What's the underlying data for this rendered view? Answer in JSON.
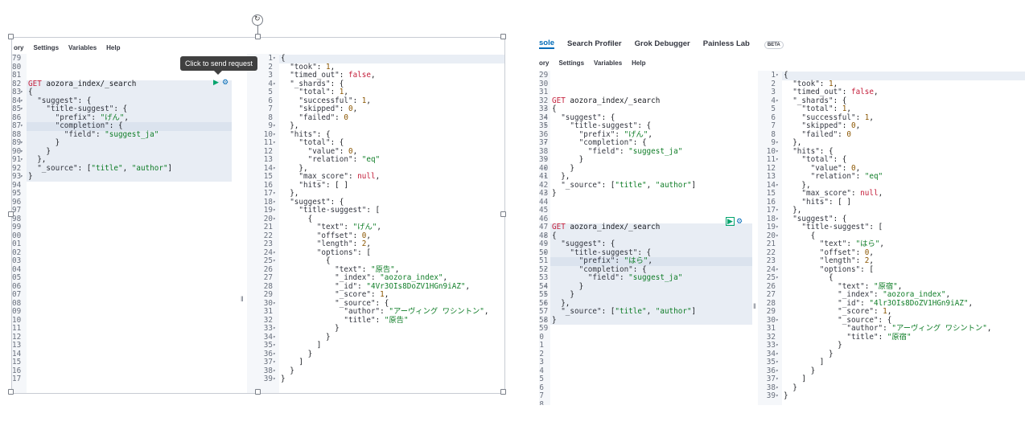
{
  "tooltip": "Click to send request",
  "menu": [
    "ory",
    "Settings",
    "Variables",
    "Help"
  ],
  "top_tabs": [
    "sole",
    "Search Profiler",
    "Grok Debugger",
    "Painless Lab",
    "BETA"
  ],
  "left_request": {
    "start_num": 79,
    "lines": [
      {
        "n": "79",
        "t": ""
      },
      {
        "n": "80",
        "t": ""
      },
      {
        "n": "81",
        "t": ""
      },
      {
        "n": "82",
        "t": "GET aozora_index/_search",
        "req": true
      },
      {
        "n": "83",
        "t": "{",
        "req": true,
        "fold": true
      },
      {
        "n": "84",
        "t": "  \"suggest\": {",
        "req": true,
        "fold": true
      },
      {
        "n": "85",
        "t": "    \"title-suggest\": {",
        "req": true,
        "fold": true
      },
      {
        "n": "86",
        "t": "      \"prefix\": \"げん\",",
        "req": true
      },
      {
        "n": "87",
        "t": "      \"completion\": {",
        "req": true,
        "fold": true,
        "active": true
      },
      {
        "n": "88",
        "t": "        \"field\": \"suggest_ja\"",
        "req": true
      },
      {
        "n": "89",
        "t": "      }",
        "req": true,
        "fold": true
      },
      {
        "n": "90",
        "t": "    }",
        "req": true,
        "fold": true
      },
      {
        "n": "91",
        "t": "  },",
        "req": true,
        "fold": true
      },
      {
        "n": "92",
        "t": "  \"_source\": [\"title\", \"author\"]",
        "req": true
      },
      {
        "n": "93",
        "t": "}",
        "req": true,
        "fold": true
      },
      {
        "n": "94",
        "t": ""
      },
      {
        "n": "95",
        "t": ""
      },
      {
        "n": "96",
        "t": ""
      },
      {
        "n": "97",
        "t": ""
      },
      {
        "n": "98",
        "t": ""
      },
      {
        "n": "99",
        "t": ""
      },
      {
        "n": "00",
        "t": ""
      },
      {
        "n": "01",
        "t": ""
      },
      {
        "n": "02",
        "t": ""
      },
      {
        "n": "03",
        "t": ""
      },
      {
        "n": "04",
        "t": ""
      },
      {
        "n": "05",
        "t": ""
      },
      {
        "n": "06",
        "t": ""
      },
      {
        "n": "07",
        "t": ""
      },
      {
        "n": "08",
        "t": ""
      },
      {
        "n": "09",
        "t": ""
      },
      {
        "n": "10",
        "t": ""
      },
      {
        "n": "11",
        "t": ""
      },
      {
        "n": "12",
        "t": ""
      },
      {
        "n": "13",
        "t": ""
      },
      {
        "n": "14",
        "t": ""
      },
      {
        "n": "15",
        "t": ""
      },
      {
        "n": "16",
        "t": ""
      },
      {
        "n": "17",
        "t": ""
      }
    ]
  },
  "left_response": {
    "lines": [
      "{",
      "  \"took\": 1,",
      "  \"timed_out\": false,",
      "  \"_shards\": {",
      "    \"total\": 1,",
      "    \"successful\": 1,",
      "    \"skipped\": 0,",
      "    \"failed\": 0",
      "  },",
      "  \"hits\": {",
      "    \"total\": {",
      "      \"value\": 0,",
      "      \"relation\": \"eq\"",
      "    },",
      "    \"max_score\": null,",
      "    \"hits\": [ ]",
      "  },",
      "  \"suggest\": {",
      "    \"title-suggest\": [",
      "      {",
      "        \"text\": \"げん\",",
      "        \"offset\": 0,",
      "        \"length\": 2,",
      "        \"options\": [",
      "          {",
      "            \"text\": \"原告\",",
      "            \"_index\": \"aozora_index\",",
      "            \"_id\": \"4Vr3OIs8DoZV1HGn9iAZ\",",
      "            \"_score\": 1,",
      "            \"_source\": {",
      "              \"author\": \"アーヴィング ワシントン\",",
      "              \"title\": \"原告\"",
      "            }",
      "          }",
      "        ]",
      "      }",
      "    ]",
      "  }",
      "}"
    ],
    "fold": [
      1,
      4,
      9,
      10,
      11,
      14,
      17,
      18,
      19,
      20,
      24,
      25,
      30,
      33,
      34,
      35,
      36,
      37,
      38,
      39
    ]
  },
  "right_request": {
    "lines": [
      {
        "n": "29",
        "t": ""
      },
      {
        "n": "30",
        "t": ""
      },
      {
        "n": "31",
        "t": ""
      },
      {
        "n": "32",
        "t": "GET aozora_index/_search"
      },
      {
        "n": "33",
        "t": "{",
        "fold": true
      },
      {
        "n": "34",
        "t": "  \"suggest\": {",
        "fold": true
      },
      {
        "n": "35",
        "t": "    \"title-suggest\": {",
        "fold": true
      },
      {
        "n": "36",
        "t": "      \"prefix\": \"げん\","
      },
      {
        "n": "37",
        "t": "      \"completion\": {",
        "fold": true
      },
      {
        "n": "38",
        "t": "        \"field\": \"suggest_ja\""
      },
      {
        "n": "39",
        "t": "      }",
        "fold": true
      },
      {
        "n": "40",
        "t": "    }",
        "fold": true
      },
      {
        "n": "41",
        "t": "  },",
        "fold": true
      },
      {
        "n": "42",
        "t": "  \"_source\": [\"title\", \"author\"]"
      },
      {
        "n": "43",
        "t": "}",
        "fold": true
      },
      {
        "n": "44",
        "t": ""
      },
      {
        "n": "45",
        "t": ""
      },
      {
        "n": "46",
        "t": ""
      },
      {
        "n": "47",
        "t": "GET aozora_index/_search",
        "req": true
      },
      {
        "n": "48",
        "t": "{",
        "req": true,
        "fold": true
      },
      {
        "n": "49",
        "t": "  \"suggest\": {",
        "req": true,
        "fold": true
      },
      {
        "n": "50",
        "t": "    \"title-suggest\": {",
        "req": true,
        "fold": true
      },
      {
        "n": "51",
        "t": "      \"prefix\": \"はら\",",
        "req": true,
        "active": true
      },
      {
        "n": "52",
        "t": "      \"completion\": {",
        "req": true,
        "fold": true
      },
      {
        "n": "53",
        "t": "        \"field\": \"suggest_ja\"",
        "req": true
      },
      {
        "n": "54",
        "t": "      }",
        "req": true,
        "fold": true
      },
      {
        "n": "55",
        "t": "    }",
        "req": true,
        "fold": true
      },
      {
        "n": "56",
        "t": "  },",
        "req": true,
        "fold": true
      },
      {
        "n": "57",
        "t": "  \"_source\": [\"title\", \"author\"]",
        "req": true
      },
      {
        "n": "58",
        "t": "}",
        "req": true,
        "fold": true
      },
      {
        "n": "59",
        "t": ""
      },
      {
        "n": "0",
        "t": ""
      },
      {
        "n": "1",
        "t": ""
      },
      {
        "n": "2",
        "t": ""
      },
      {
        "n": "3",
        "t": ""
      },
      {
        "n": "4",
        "t": ""
      },
      {
        "n": "5",
        "t": ""
      },
      {
        "n": "6",
        "t": ""
      },
      {
        "n": "7",
        "t": ""
      },
      {
        "n": "8",
        "t": ""
      }
    ]
  },
  "right_response": {
    "lines": [
      "{",
      "  \"took\": 1,",
      "  \"timed_out\": false,",
      "  \"_shards\": {",
      "    \"total\": 1,",
      "    \"successful\": 1,",
      "    \"skipped\": 0,",
      "    \"failed\": 0",
      "  },",
      "  \"hits\": {",
      "    \"total\": {",
      "      \"value\": 0,",
      "      \"relation\": \"eq\"",
      "    },",
      "    \"max_score\": null,",
      "    \"hits\": [ ]",
      "  },",
      "  \"suggest\": {",
      "    \"title-suggest\": [",
      "      {",
      "        \"text\": \"はら\",",
      "        \"offset\": 0,",
      "        \"length\": 2,",
      "        \"options\": [",
      "          {",
      "            \"text\": \"原宿\",",
      "            \"_index\": \"aozora_index\",",
      "            \"_id\": \"4lr3OIs8DoZV1HGn9iAZ\",",
      "            \"_score\": 1,",
      "            \"_source\": {",
      "              \"author\": \"アーヴィング ワシントン\",",
      "              \"title\": \"原宿\"",
      "            }",
      "          }",
      "        ]",
      "      }",
      "    ]",
      "  }",
      "}"
    ],
    "fold": [
      1,
      4,
      9,
      10,
      11,
      14,
      17,
      18,
      19,
      20,
      24,
      25,
      30,
      33,
      34,
      35,
      36,
      37,
      38,
      39
    ]
  },
  "colors": {
    "string": "#0f7d27",
    "method": "#c41e3a",
    "keyword_false": "#c41e3a",
    "play_icon": "#00a36c"
  },
  "icons": [
    "play-icon",
    "wrench-icon",
    "rotate-icon",
    "drag-handle-icon"
  ]
}
